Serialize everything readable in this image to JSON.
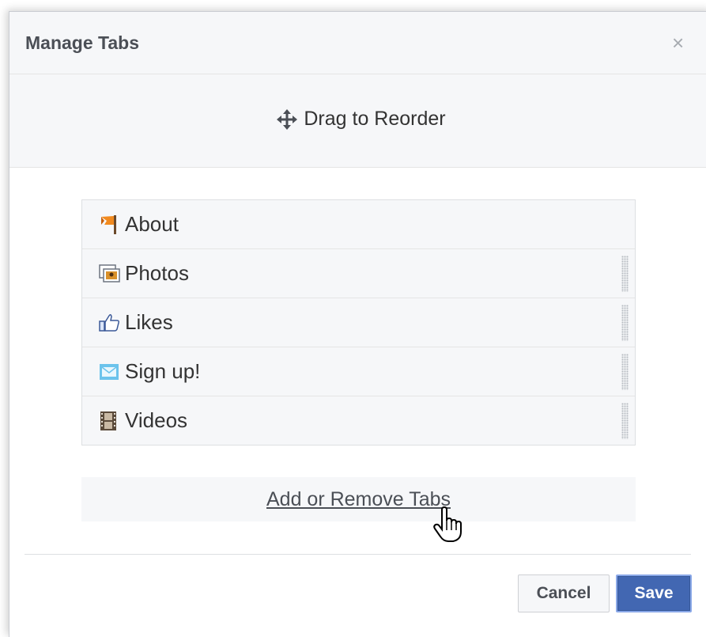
{
  "dialog": {
    "title": "Manage Tabs",
    "close_label": "×",
    "drag_hint": "Drag to Reorder",
    "tabs": [
      {
        "label": "About",
        "icon": "flag-icon"
      },
      {
        "label": "Photos",
        "icon": "photos-icon"
      },
      {
        "label": "Likes",
        "icon": "thumbs-up-icon"
      },
      {
        "label": "Sign up!",
        "icon": "envelope-icon"
      },
      {
        "label": "Videos",
        "icon": "film-icon"
      }
    ],
    "add_remove_label": "Add or Remove Tabs",
    "cancel_label": "Cancel",
    "save_label": "Save"
  },
  "colors": {
    "accent": "#4267b2",
    "header_bg": "#f6f7f9",
    "text": "#333333"
  }
}
